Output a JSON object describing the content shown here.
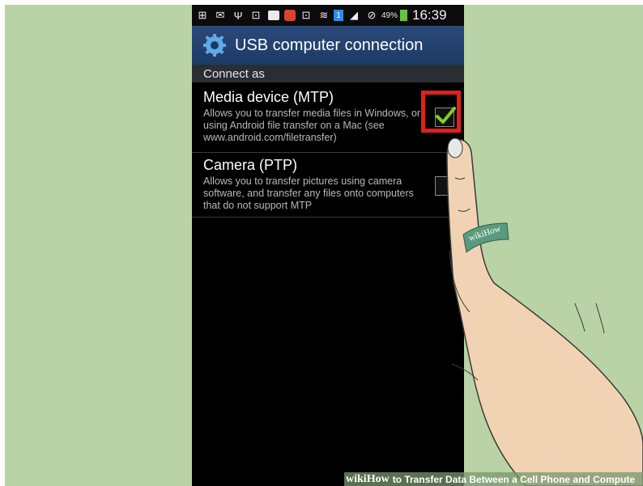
{
  "status_bar": {
    "icons": [
      "add-icon",
      "mail-icon",
      "usb-icon",
      "cast-icon",
      "image-icon",
      "app-icon",
      "cast-icon",
      "wifi-icon",
      "sim-icon",
      "signal-icon",
      "no-sim-icon"
    ],
    "sim": "1",
    "battery": "49%",
    "time": "16:39"
  },
  "header": {
    "title": "USB computer connection"
  },
  "section": {
    "label": "Connect as"
  },
  "options": [
    {
      "title": "Media device (MTP)",
      "description": "Allows you to transfer media files in Windows, or using Android file transfer on a Mac (see www.android.com/filetransfer)",
      "checked": true
    },
    {
      "title": "Camera (PTP)",
      "description": "Allows you to transfer pictures using camera software, and transfer any files onto computers that do not support MTP",
      "checked": false
    }
  ],
  "ring_label": "wikiHow",
  "footer": {
    "wiki": "wiki",
    "how": "How",
    "caption": "to Transfer Data Between a Cell Phone and Compute"
  },
  "colors": {
    "background": "#bad3a6",
    "highlight": "#e0201b",
    "check": "#7ed321",
    "header": "#1c3a66"
  }
}
